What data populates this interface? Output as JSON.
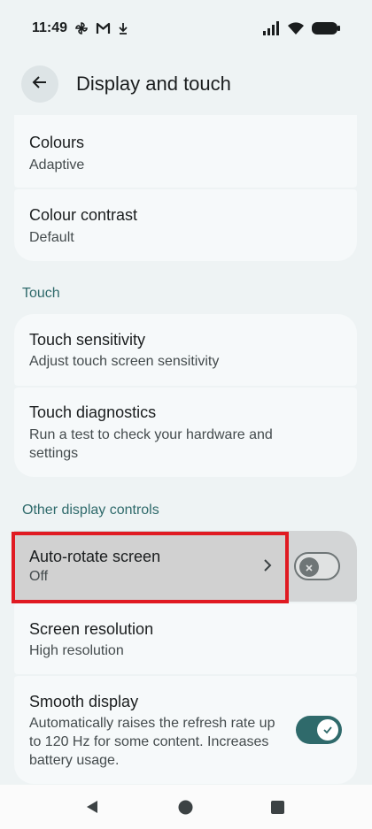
{
  "status_bar": {
    "time": "11:49",
    "left_icons": [
      "pinwheel-icon",
      "gmail-icon",
      "download-icon"
    ],
    "right_icons": [
      "signal-icon",
      "wifi-icon",
      "battery-icon"
    ]
  },
  "header": {
    "title": "Display and touch"
  },
  "items": {
    "colours": {
      "title": "Colours",
      "subtitle": "Adaptive"
    },
    "colour_contrast": {
      "title": "Colour contrast",
      "subtitle": "Default"
    },
    "touch_sensitivity": {
      "title": "Touch sensitivity",
      "subtitle": "Adjust touch screen sensitivity"
    },
    "touch_diagnostics": {
      "title": "Touch diagnostics",
      "subtitle": "Run a test to check your hardware and settings"
    },
    "auto_rotate": {
      "title": "Auto-rotate screen",
      "subtitle": "Off",
      "enabled": false
    },
    "screen_resolution": {
      "title": "Screen resolution",
      "subtitle": "High resolution"
    },
    "smooth_display": {
      "title": "Smooth display",
      "subtitle": "Automatically raises the refresh rate up to 120 Hz for some content. Increases battery usage.",
      "enabled": true
    }
  },
  "sections": {
    "touch": "Touch",
    "other_display": "Other display controls"
  },
  "colors": {
    "accent": "#2f6a6b",
    "highlight": "#e01a22",
    "background": "#eef3f4",
    "card": "#f6f9fa"
  }
}
